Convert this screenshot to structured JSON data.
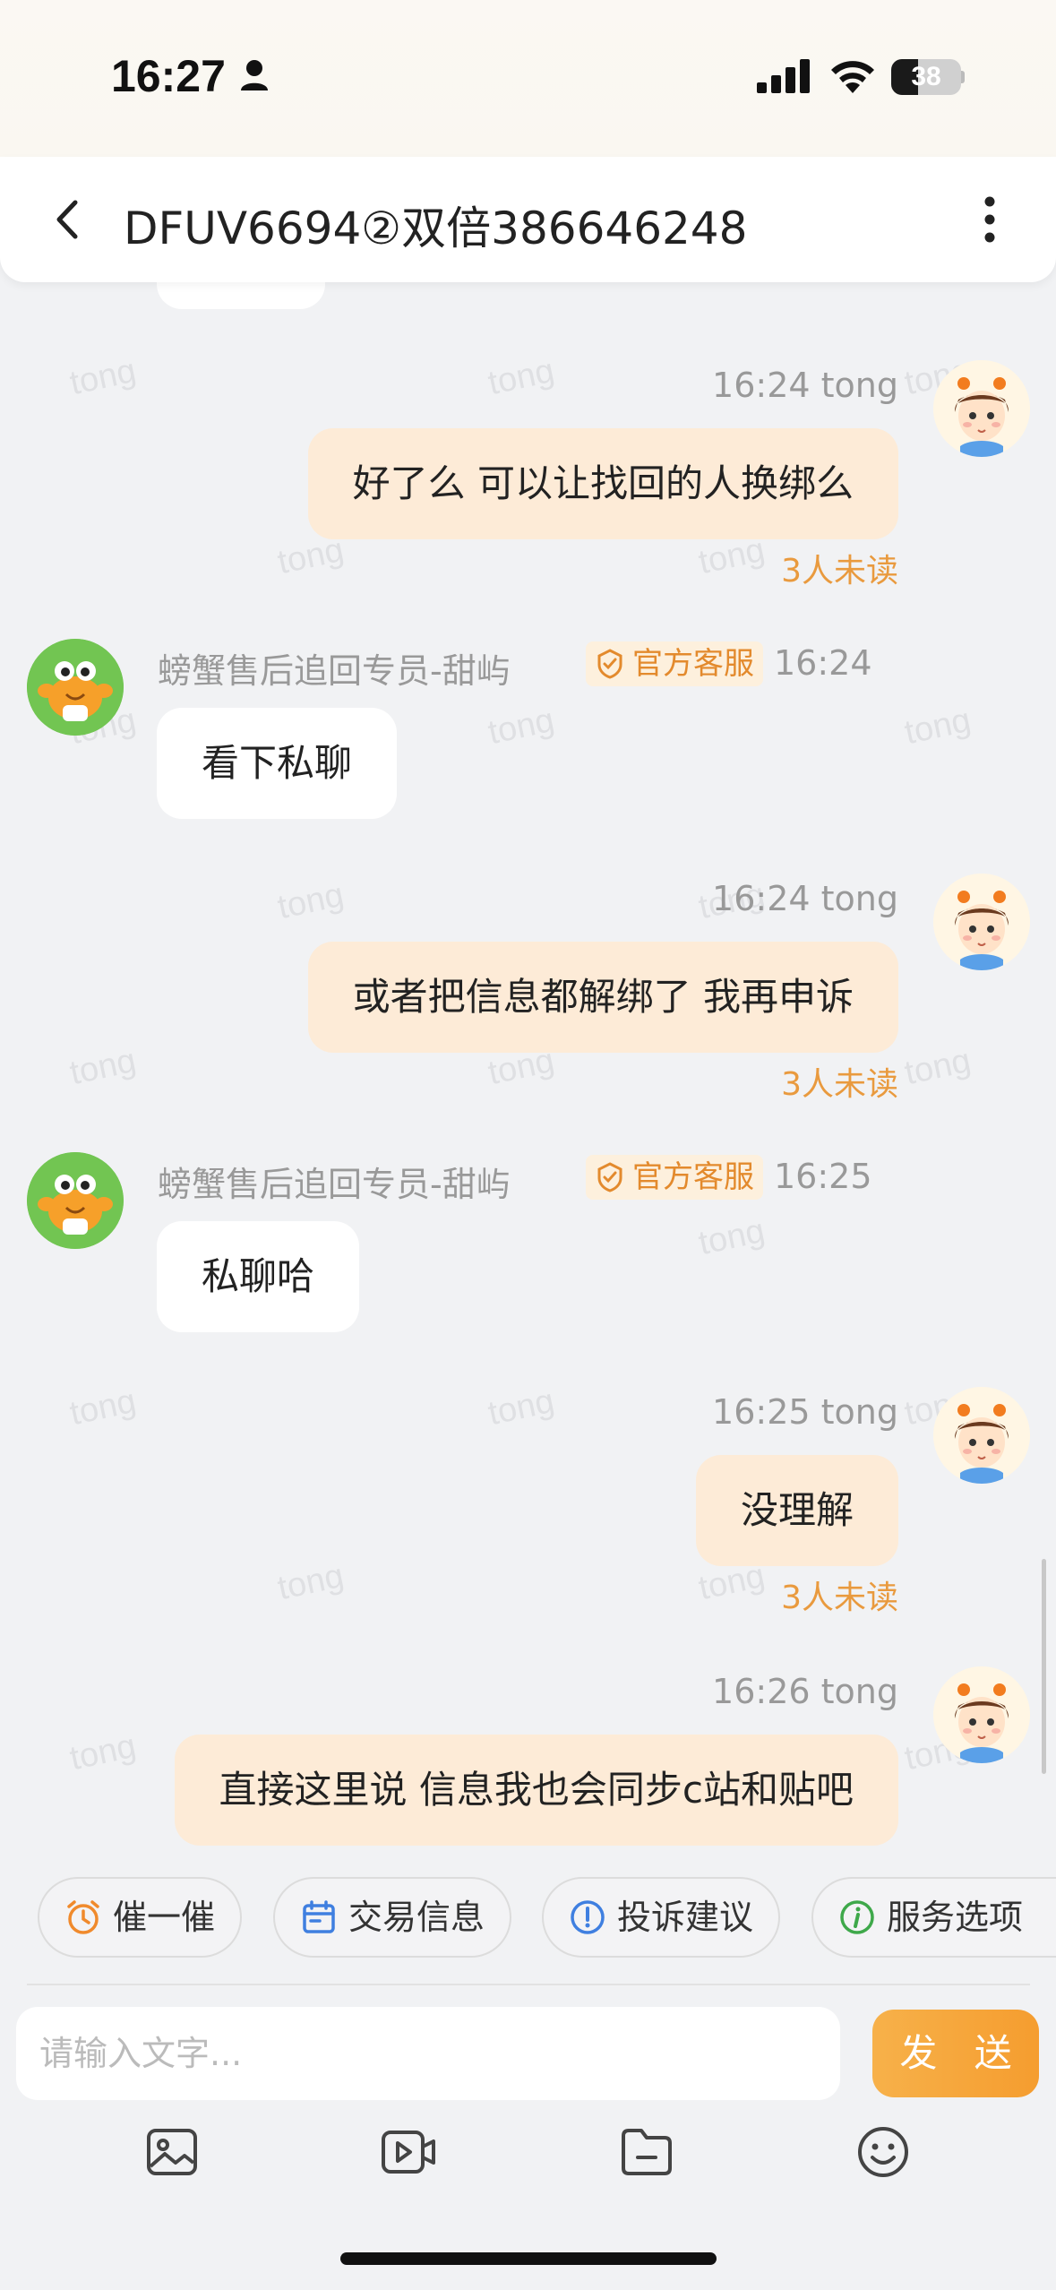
{
  "status_bar": {
    "time": "16:27",
    "battery_level": "38",
    "battery_fraction": 0.38
  },
  "header": {
    "title": "DFUV6694②双倍386646248",
    "back_icon": "chevron-left-icon",
    "more_icon": "vertical-dots-icon"
  },
  "watermark_text": "tong",
  "messages": [
    {
      "sender": "tong",
      "time": "16:24",
      "text": "好了么 可以让找回的人换绑么",
      "unread": "3人未读"
    },
    {
      "sender": "螃蟹售后追回专员-甜屿",
      "badge": "官方客服",
      "time": "16:24",
      "text": "看下私聊"
    },
    {
      "sender": "tong",
      "time": "16:24",
      "text": "或者把信息都解绑了 我再申诉",
      "unread": "3人未读"
    },
    {
      "sender": "螃蟹售后追回专员-甜屿",
      "badge": "官方客服",
      "time": "16:25",
      "text": "私聊哈"
    },
    {
      "sender": "tong",
      "time": "16:25",
      "text": "没理解",
      "unread": "3人未读"
    },
    {
      "sender": "tong",
      "time": "16:26",
      "text": "直接这里说 信息我也会同步c站和贴吧"
    }
  ],
  "quick_actions": [
    {
      "label": "催一催",
      "icon": "alarm-clock-icon"
    },
    {
      "label": "交易信息",
      "icon": "calendar-icon"
    },
    {
      "label": "投诉建议",
      "icon": "exclamation-circle-icon"
    },
    {
      "label": "服务选项",
      "icon": "info-circle-icon"
    }
  ],
  "composer": {
    "placeholder": "请输入文字...",
    "send_label": "发 送"
  },
  "toolbar_icons": [
    "image-icon",
    "video-icon",
    "folder-icon",
    "emoji-icon"
  ],
  "colors": {
    "accent": "#F5A33A",
    "unread": "#E99A3E",
    "my_bubble": "#FDEBD7",
    "staff_avatar": "#67C04A"
  }
}
